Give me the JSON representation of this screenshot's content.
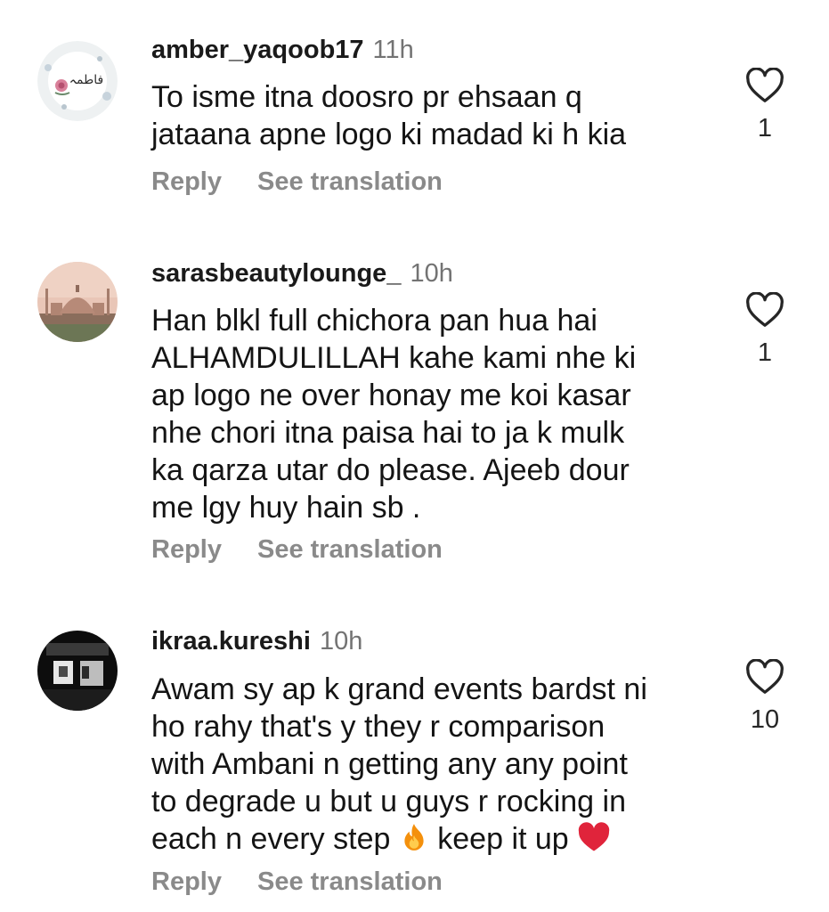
{
  "comments": [
    {
      "username": "amber_yaqoob17",
      "time": "11h",
      "lines": [
        "To isme itna doosro pr ehsaan q",
        "jataana apne logo ki madad ki h kia"
      ],
      "reply_label": "Reply",
      "translate_label": "See translation",
      "like_count": "1",
      "avatar_text": "فاطمہ"
    },
    {
      "username": "sarasbeautylounge_",
      "time": "10h",
      "lines": [
        "Han blkl full chichora pan hua hai",
        "ALHAMDULILLAH kahe kami nhe ki",
        "ap logo ne over honay me koi kasar",
        "nhe chori itna paisa hai to ja k mulk",
        "ka qarza utar do please. Ajeeb dour",
        "me lgy huy hain sb ."
      ],
      "reply_label": "Reply",
      "translate_label": "See translation",
      "like_count": "1"
    },
    {
      "username": "ikraa.kureshi",
      "time": "10h",
      "lines": [
        "Awam sy ap k grand events bardst ni",
        "ho rahy that's y they r comparison",
        "with Ambani n getting any any point",
        "to degrade u but u guys r rocking in"
      ],
      "last_line_a": "each n every step ",
      "last_line_b": " keep it up ",
      "reply_label": "Reply",
      "translate_label": "See translation",
      "like_count": "10"
    }
  ],
  "icons": [
    "heart-outline-icon",
    "fire-emoji-icon",
    "red-heart-emoji-icon"
  ],
  "colors": {
    "text": "#141414",
    "muted": "#737373",
    "action": "#8a8a8a",
    "emoji_heart": "#e0243b"
  }
}
